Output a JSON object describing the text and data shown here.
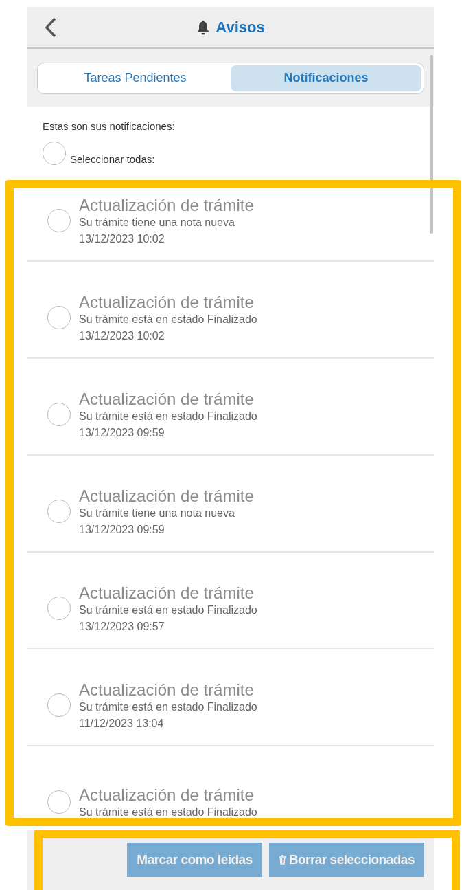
{
  "header": {
    "title": "Avisos"
  },
  "tabs": [
    {
      "label": "Tareas Pendientes",
      "selected": false
    },
    {
      "label": "Notificaciones",
      "selected": true
    }
  ],
  "intro": "Estas son sus notificaciones:",
  "select_all": {
    "label": "Seleccionar todas:",
    "checked": false
  },
  "notifications": [
    {
      "title": "Actualización de trámite",
      "message": "Su trámite tiene una nota nueva",
      "date": "13/12/2023 10:02",
      "checked": false
    },
    {
      "title": "Actualización de trámite",
      "message": "Su trámite está en estado Finalizado",
      "date": "13/12/2023 10:02",
      "checked": false
    },
    {
      "title": "Actualización de trámite",
      "message": "Su trámite está en estado Finalizado",
      "date": "13/12/2023 09:59",
      "checked": false
    },
    {
      "title": "Actualización de trámite",
      "message": "Su trámite tiene una nota nueva",
      "date": "13/12/2023 09:59",
      "checked": false
    },
    {
      "title": "Actualización de trámite",
      "message": "Su trámite está en estado Finalizado",
      "date": "13/12/2023 09:57",
      "checked": false
    },
    {
      "title": "Actualización de trámite",
      "message": "Su trámite está en estado Finalizado",
      "date": "11/12/2023 13:04",
      "checked": false
    },
    {
      "title": "Actualización de trámite",
      "message": "Su trámite está en estado Finalizado",
      "checked": false
    }
  ],
  "footer": {
    "buttons": [
      {
        "label": "Marcar como leidas",
        "kind": "plain"
      },
      {
        "label": "Borrar seleccionadas",
        "kind": "trash"
      }
    ]
  }
}
